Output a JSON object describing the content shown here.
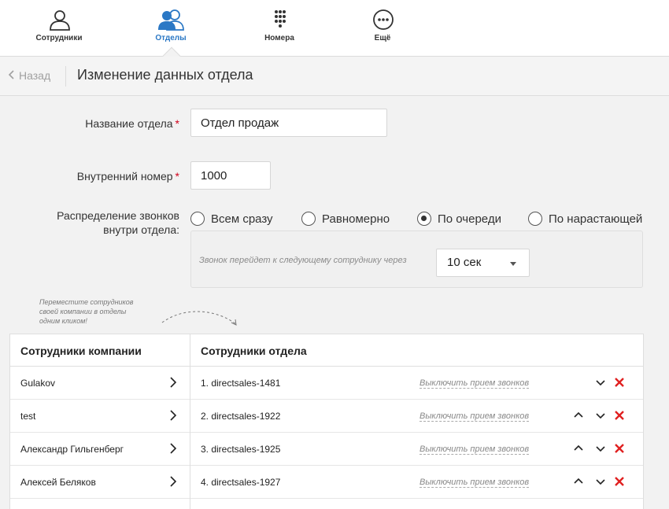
{
  "nav": {
    "items": [
      {
        "label": "Сотрудники",
        "icon": "person-icon"
      },
      {
        "label": "Отделы",
        "icon": "people-icon"
      },
      {
        "label": "Номера",
        "icon": "dialpad-icon"
      },
      {
        "label": "Ещё",
        "icon": "more-icon"
      }
    ],
    "active_index": 1,
    "accent": "#2b78c5"
  },
  "header": {
    "back_label": "Назад",
    "title": "Изменение данных отдела"
  },
  "form": {
    "name_label": "Название отдела",
    "name_value": "Отдел продаж",
    "ext_label": "Внутренний номер",
    "ext_value": "1000",
    "required_mark": "*",
    "dist_label_1": "Распределение звонков",
    "dist_label_2": "внутри отдела:",
    "dist_options": [
      "Всем сразу",
      "Равномерно",
      "По очереди",
      "По нарастающей"
    ],
    "dist_selected": 2,
    "delay_note": "Звонок перейдет к следующему сотруднику через",
    "delay_value": "10 сек"
  },
  "hint": {
    "line1": "Переместите сотрудников",
    "line2": "своей компании в отделы",
    "line3": "одним кликом!"
  },
  "company": {
    "header": "Сотрудники компании",
    "rows": [
      "Gulakov",
      "test",
      "Александр Гильгенберг",
      "Алексей Беляков"
    ]
  },
  "department": {
    "header": "Сотрудники отдела",
    "disable_label": "Выключить прием звонков",
    "rows": [
      {
        "name": "1.  directsales-1481",
        "up": false,
        "down": true
      },
      {
        "name": "2.  directsales-1922",
        "up": true,
        "down": true
      },
      {
        "name": "3.  directsales-1925",
        "up": true,
        "down": true
      },
      {
        "name": "4.  directsales-1927",
        "up": true,
        "down": true
      }
    ]
  },
  "colors": {
    "required": "#d0021b",
    "remove": "#e02020"
  }
}
